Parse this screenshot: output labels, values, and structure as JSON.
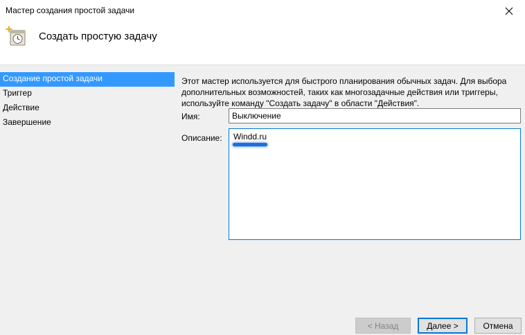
{
  "window": {
    "title": "Мастер создания простой задачи"
  },
  "header": {
    "title": "Создать простую задачу",
    "icon": "task-scheduler-icon"
  },
  "sidebar": {
    "items": [
      {
        "label": "Создание простой задачи",
        "active": true
      },
      {
        "label": "Триггер",
        "active": false
      },
      {
        "label": "Действие",
        "active": false
      },
      {
        "label": "Завершение",
        "active": false
      }
    ]
  },
  "main": {
    "intro_lines": [
      "Этот мастер используется для быстрого планирования обычных задач.  Для выбора",
      "дополнительных возможностей, таких как многозадачные действия или триггеры,",
      "используйте команду \"Создать задачу\" в области \"Действия\"."
    ],
    "name_label": "Имя:",
    "name_value": "Выключение",
    "description_label": "Описание:",
    "description_value": "Windd.ru"
  },
  "buttons": {
    "back": "< Назад",
    "next": "Далее >",
    "cancel": "Отмена"
  },
  "colors": {
    "selection": "#3399ff",
    "focus_border": "#0078d7",
    "highlight_mark": "#1e6fd9"
  }
}
